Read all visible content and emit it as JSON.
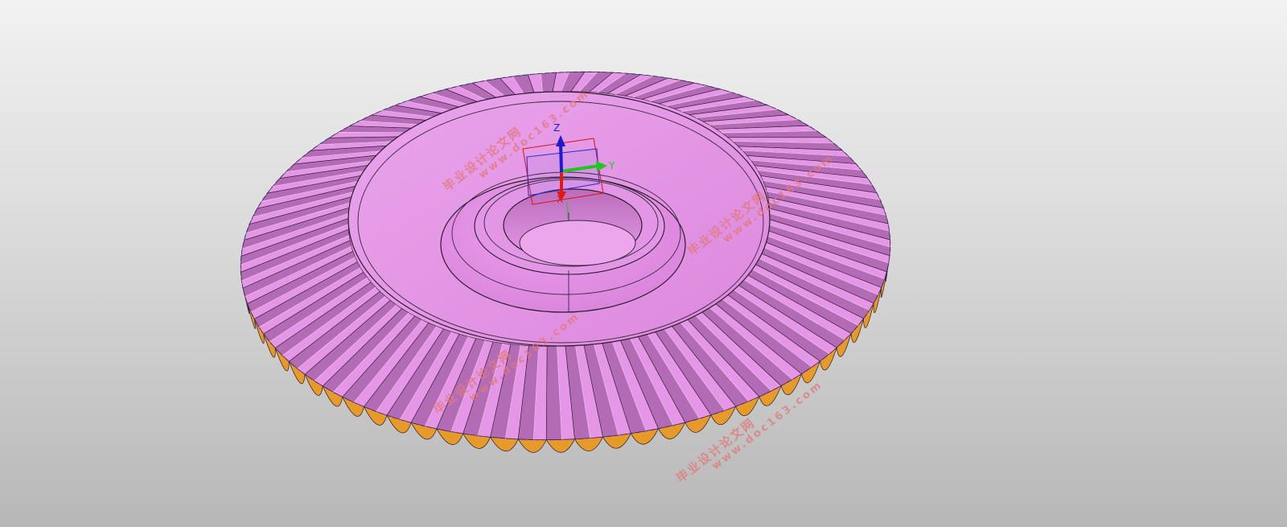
{
  "viewport": {
    "background_top": "#f2f2f2",
    "background_bottom": "#b7b7b7"
  },
  "model": {
    "name": "bevel-gear",
    "tooth_count_visible": 72,
    "face_color": "#e596e6",
    "face_shade_color": "#b46bb6",
    "underside_color": "#e79a2a",
    "edge_color": "#2a1c2a"
  },
  "triad": {
    "x_label": "X",
    "y_label": "Y",
    "z_label": "Z",
    "x_color": "#e01818",
    "y_color": "#22c422",
    "z_color": "#1c1ccc"
  },
  "watermarks": [
    {
      "cn": "毕业设计论文网",
      "url": "www.doc163.com"
    },
    {
      "cn": "毕业设计论文网",
      "url": "www.doc163.com"
    },
    {
      "cn": "毕业设计论文网",
      "url": "www.doc163.com"
    },
    {
      "cn": "毕业设计论文网",
      "url": "www.doc163.com"
    }
  ]
}
